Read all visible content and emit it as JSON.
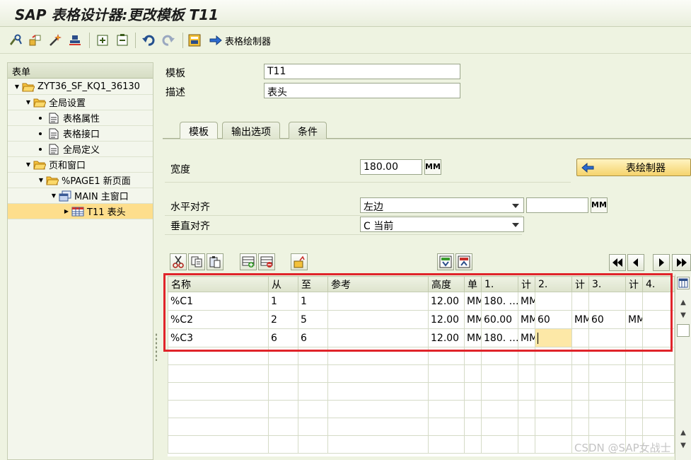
{
  "window": {
    "title": "SAP 表格设计器:更改模板 T11"
  },
  "toolbar": {
    "icons": [
      "display-change-icon",
      "toggle-icon",
      "magic-wand-icon",
      "stamp-icon",
      "expand-icon",
      "collapse-icon",
      "undo-icon",
      "redo-icon",
      "form-painter-icon"
    ],
    "table_painter_label": "表格绘制器"
  },
  "tree": {
    "header": "表单",
    "items": [
      {
        "label": "ZYT36_SF_KQ1_36130"
      },
      {
        "label": "全局设置"
      },
      {
        "label": "表格属性"
      },
      {
        "label": "表格接口"
      },
      {
        "label": "全局定义"
      },
      {
        "label": "页和窗口"
      },
      {
        "label": "%PAGE1 新页面"
      },
      {
        "label": "MAIN 主窗口"
      },
      {
        "label": "T11 表头"
      }
    ]
  },
  "form": {
    "template_label": "模板",
    "template_value": "T11",
    "desc_label": "描述",
    "desc_value": "表头"
  },
  "tabs": [
    {
      "label": "模板"
    },
    {
      "label": "输出选项"
    },
    {
      "label": "条件"
    }
  ],
  "layout": {
    "width_label": "宽度",
    "width_value": "180.00",
    "width_unit": "MM",
    "table_painter_button": "表绘制器",
    "halign_label": "水平对齐",
    "halign_value": "左边",
    "halign_offset": "",
    "halign_unit": "MM",
    "valign_label": "垂直对齐",
    "valign_value": "C 当前"
  },
  "grid": {
    "columns": [
      "名称",
      "从",
      "至",
      "参考",
      "高度",
      "单",
      "1.",
      "计",
      "2.",
      "计",
      "3.",
      "计",
      "4."
    ],
    "rows": [
      [
        "%C1",
        "1",
        "1",
        "",
        "12.00",
        "MM",
        "180. …",
        "MM",
        "",
        "",
        "",
        "",
        ""
      ],
      [
        "%C2",
        "2",
        "5",
        "",
        "12.00",
        "MM",
        "60.00",
        "MM",
        "60",
        "MM",
        "60",
        "MM",
        ""
      ],
      [
        "%C3",
        "6",
        "6",
        "",
        "12.00",
        "MM",
        "180. …",
        "MM",
        "",
        "",
        "",
        "",
        ""
      ]
    ]
  },
  "watermark": "CSDN @SAP女战士",
  "colors": {
    "highlight": "#fdde8c",
    "frame": "#e0242a",
    "background": "#eef3e1"
  }
}
